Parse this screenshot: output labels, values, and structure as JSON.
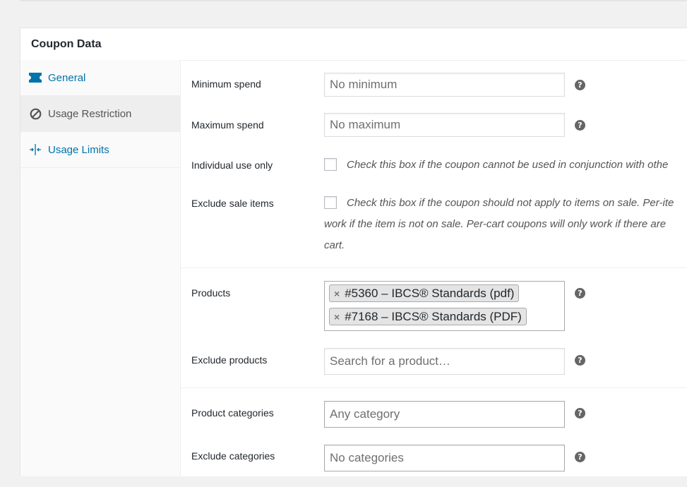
{
  "panel": {
    "title": "Coupon Data"
  },
  "tabs": [
    {
      "label": "General",
      "icon": "ticket-icon",
      "active": false
    },
    {
      "label": "Usage Restriction",
      "icon": "ban-icon",
      "active": true
    },
    {
      "label": "Usage Limits",
      "icon": "arrows-in-icon",
      "active": false
    }
  ],
  "fields": {
    "minimum_spend": {
      "label": "Minimum spend",
      "placeholder": "No minimum",
      "help": "?"
    },
    "maximum_spend": {
      "label": "Maximum spend",
      "placeholder": "No maximum",
      "help": "?"
    },
    "individual_use": {
      "label": "Individual use only",
      "description": "Check this box if the coupon cannot be used in conjunction with othe"
    },
    "exclude_sale": {
      "label": "Exclude sale items",
      "description_line1": "Check this box if the coupon should not apply to items on sale. Per-ite",
      "description_line2": "work if the item is not on sale. Per-cart coupons will only work if there are",
      "description_line3": "cart."
    },
    "products": {
      "label": "Products",
      "selected": [
        "#5360 – IBCS® Standards (pdf)",
        "#7168 – IBCS® Standards (PDF)"
      ],
      "remove_glyph": "×",
      "help": "?"
    },
    "exclude_products": {
      "label": "Exclude products",
      "placeholder": "Search for a product…",
      "help": "?"
    },
    "product_categories": {
      "label": "Product categories",
      "placeholder": "Any category",
      "help": "?"
    },
    "exclude_categories": {
      "label": "Exclude categories",
      "placeholder": "No categories",
      "help": "?"
    }
  },
  "colors": {
    "link": "#0073aa",
    "active_tab_bg": "#eeeeee",
    "help_icon": "#666666"
  }
}
